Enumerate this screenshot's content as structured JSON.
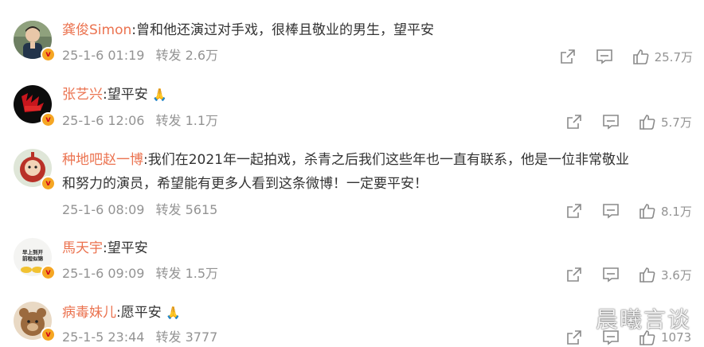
{
  "comments": [
    {
      "user": "龚俊Simon",
      "text": ":曾和他还演过对手戏，很棒且敬业的男生，望平安",
      "text2": "",
      "date": "25-1-6 01:19",
      "repost_label": "转发",
      "repost_count": "2.6万",
      "likes": "25.7万",
      "emoji": ""
    },
    {
      "user": "张艺兴",
      "text": ":望平安",
      "text2": "",
      "date": "25-1-6 12:06",
      "repost_label": "转发",
      "repost_count": "1.1万",
      "likes": "5.7万",
      "emoji": "🙏"
    },
    {
      "user": "种地吧赵一博",
      "text": ":我们在2021年一起拍戏，杀青之后我们这些年也一直有联系，他是一位非常敬业",
      "text2": "和努力的演员，希望能有更多人看到这条微博！一定要平安！",
      "date": "25-1-6 08:09",
      "repost_label": "转发",
      "repost_count": "5615",
      "likes": "8.1万",
      "emoji": ""
    },
    {
      "user": "馬天宇",
      "text": ":望平安",
      "text2": "",
      "date": "25-1-6 09:09",
      "repost_label": "转发",
      "repost_count": "1.5万",
      "likes": "3.6万",
      "emoji": ""
    },
    {
      "user": "病毒妹儿",
      "text": ":愿平安",
      "text2": "",
      "date": "25-1-5 23:44",
      "repost_label": "转发",
      "repost_count": "3777",
      "likes": "1073",
      "emoji": "🙏"
    }
  ],
  "avatar_badge": "v",
  "avatar_text_4": "早上到开前程似锦",
  "watermark": "晨曦言谈",
  "icons": {
    "share": "share-icon",
    "comment": "comment-icon",
    "like": "thumbs-up-icon",
    "verified": "verified-badge-icon"
  },
  "colors": {
    "username": "#eb7350",
    "text": "#333333",
    "meta": "#939393",
    "badge": "#f5a623"
  }
}
